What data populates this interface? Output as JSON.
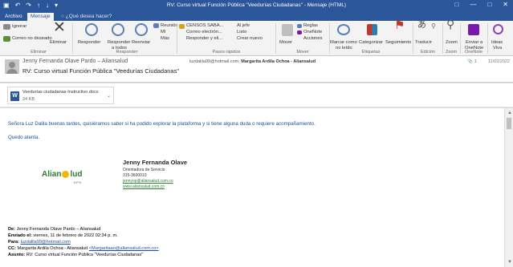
{
  "window": {
    "title": "RV: Curso virtual Función Pública \"Veedurías Ciudadanas\" - Mensaje (HTML)",
    "qat_icons": [
      "save-icon",
      "undo-icon",
      "redo-icon",
      "up-arrow-icon",
      "down-arrow-icon",
      "qat-menu-icon"
    ],
    "controls": [
      "ribbon-options-icon",
      "minimize-icon",
      "maximize-icon",
      "close-icon"
    ]
  },
  "tabs": {
    "archivo": "Archivo",
    "mensaje": "Mensaje",
    "tell_me": "¿Qué desea hacer?"
  },
  "ribbon": {
    "eliminar": {
      "ignorar": "Ignorar",
      "correo_no_deseado": "Correo no deseado",
      "eliminar": "Eliminar",
      "group": "Eliminar"
    },
    "responder": {
      "responder": "Responder",
      "responder_todos_1": "Responder",
      "responder_todos_2": "a todos",
      "reenviar": "Reenviar",
      "reunion": "Reunión",
      "mi": "MI",
      "mas": "Más",
      "group": "Responder"
    },
    "pasos": {
      "censos": "CENSOS SABA...",
      "correo_electronico": "Correo electrón...",
      "responder_elim": "Responder y eli...",
      "al_jefe": "Al jefe",
      "listo": "Listo",
      "crear_nuevo": "Crear nuevo",
      "group": "Pasos rápidos"
    },
    "mover": {
      "mover": "Mover",
      "reglas": "Reglas",
      "onenote": "OneNote",
      "acciones": "Acciones",
      "group": "Mover"
    },
    "etiquetas": {
      "marcar_1": "Marcar como",
      "marcar_2": "no leído",
      "categorizar": "Categorizar",
      "seguimiento": "Seguimiento",
      "group": "Etiquetas"
    },
    "edicion": {
      "traducir": "Traducir",
      "group": "Edición"
    },
    "zoom": {
      "zoom": "Zoom",
      "group": "Zoom"
    },
    "onenote": {
      "enviar_1": "Enviar a",
      "enviar_2": "OneNote",
      "group": "OneNote"
    },
    "ideas": {
      "ideas": "Ideas",
      "viva": "Viva"
    }
  },
  "message": {
    "sender": "Jenny Fernanda Olave Pardo – Aliansalud",
    "recipients_prefix": "luzdalila99@hotmail.com;",
    "cc_label": "Margarita Ardila Ochoa - Aliansalud",
    "subject": "RV: Curso virtual Función Pública \"Veedurías Ciudadanas\"",
    "count": "1",
    "date": "11/02/2022"
  },
  "attachment": {
    "name": "Veedurías ciudadanas-Instructivo.docx",
    "size": "24 KB"
  },
  "body": {
    "greeting": "Señora Luz Dalila buenas tardes, quisiéramos saber si ha podido explorar la plataforma y si tiene alguna duda o requiere acompañamiento.",
    "closing": "Quedo atenta.",
    "signature": {
      "logo_text_1": "Alian",
      "logo_text_2": "lud",
      "logo_sub": "EPS",
      "name": "Jenny Fernanda Olave",
      "role": "Orientadora de Servicio",
      "phone": "315-3600010",
      "email": "jennyop@aliansalud.com.co",
      "website": "www.aliansalud.com.co"
    },
    "forwarded": {
      "de_label": "De:",
      "de": "Jenny Fernanda Olave Pardo – Aliansalud",
      "enviado_label": "Enviado el:",
      "enviado": "viernes, 11 de febrero de 2022 02:34 p. m.",
      "para_label": "Para:",
      "para": "luzdalila99@hotmail.com",
      "cc_label": "CC:",
      "cc_name": "Margarita Ardila Ochoa - Aliansalud",
      "cc_email": "<Margaritaao@aliansalud.com.co>",
      "asunto_label": "Asunto:",
      "asunto": "RV: Curso virtual Función Pública \"Veedurías Ciudadanas\""
    }
  }
}
